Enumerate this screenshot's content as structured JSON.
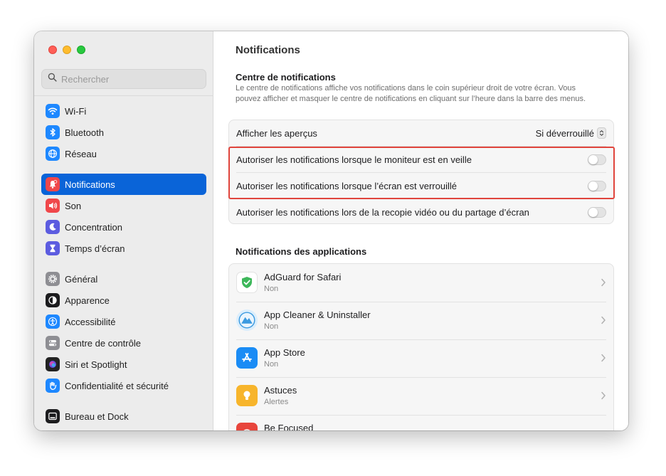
{
  "sidebar": {
    "search_placeholder": "Rechercher",
    "items": [
      {
        "label": "Wi-Fi",
        "icon": "wifi-icon",
        "color": "#1e88ff"
      },
      {
        "label": "Bluetooth",
        "icon": "bluetooth-icon",
        "color": "#1e88ff"
      },
      {
        "label": "Réseau",
        "icon": "globe-icon",
        "color": "#1e88ff"
      },
      {
        "label": "Notifications",
        "icon": "bell-icon",
        "color": "#f0474a",
        "active": true
      },
      {
        "label": "Son",
        "icon": "speaker-icon",
        "color": "#f0474a"
      },
      {
        "label": "Concentration",
        "icon": "moon-icon",
        "color": "#5c5ce0"
      },
      {
        "label": "Temps d’écran",
        "icon": "hourglass-icon",
        "color": "#5c5ce0"
      },
      {
        "label": "Général",
        "icon": "gear-icon",
        "color": "#8e8e93"
      },
      {
        "label": "Apparence",
        "icon": "appearance-icon",
        "color": "#1c1c1e"
      },
      {
        "label": "Accessibilité",
        "icon": "accessibility-icon",
        "color": "#1e88ff"
      },
      {
        "label": "Centre de contrôle",
        "icon": "control-center-icon",
        "color": "#8e8e93"
      },
      {
        "label": "Siri et Spotlight",
        "icon": "siri-icon",
        "color": "#222222"
      },
      {
        "label": "Confidentialité et sécurité",
        "icon": "hand-icon",
        "color": "#1e88ff"
      },
      {
        "label": "Bureau et Dock",
        "icon": "dock-icon",
        "color": "#1c1c1e"
      }
    ]
  },
  "main": {
    "title": "Notifications",
    "center": {
      "title": "Centre de notifications",
      "description": "Le centre de notifications affiche vos notifications dans le coin supérieur droit de votre écran. Vous pouvez afficher et masquer le centre de notifications en cliquant sur l’heure dans la barre des menus.",
      "preview_label": "Afficher les aperçus",
      "preview_value": "Si déverrouillé",
      "options": [
        {
          "label": "Autoriser les notifications lorsque le moniteur est en veille",
          "enabled": false
        },
        {
          "label": "Autoriser les notifications lorsque l’écran est verrouillé",
          "enabled": false
        },
        {
          "label": "Autoriser les notifications lors de la recopie vidéo ou du partage d’écran",
          "enabled": false
        }
      ]
    },
    "apps": {
      "title": "Notifications des applications",
      "items": [
        {
          "name": "AdGuard for Safari",
          "status": "Non",
          "icon": "adguard-icon"
        },
        {
          "name": "App Cleaner & Uninstaller",
          "status": "Non",
          "icon": "app-cleaner-icon"
        },
        {
          "name": "App Store",
          "status": "Non",
          "icon": "app-store-icon"
        },
        {
          "name": "Astuces",
          "status": "Alertes",
          "icon": "tips-icon"
        },
        {
          "name": "Be Focused",
          "status": "",
          "icon": "be-focused-icon"
        }
      ]
    }
  },
  "colors": {
    "accent": "#0a64d8",
    "highlight": "#e0443c"
  }
}
